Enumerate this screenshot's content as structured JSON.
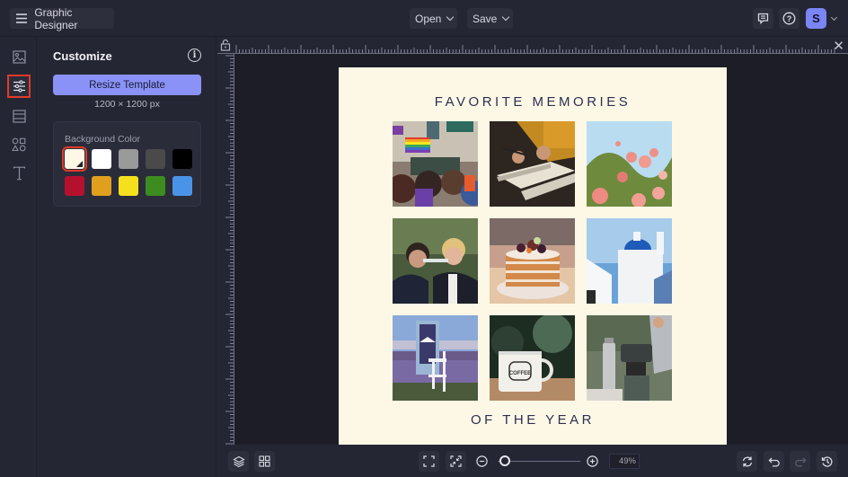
{
  "header": {
    "app_title": "Graphic Designer",
    "open_label": "Open",
    "save_label": "Save",
    "avatar_initial": "S",
    "icons": [
      "menu-icon",
      "chevron-down-icon",
      "comment-icon",
      "help-icon",
      "avatar",
      "chevron-down-icon"
    ]
  },
  "rail": {
    "items": [
      {
        "name": "photos",
        "icon": "image-icon",
        "active": false
      },
      {
        "name": "customize",
        "icon": "sliders-icon",
        "active": true
      },
      {
        "name": "layouts",
        "icon": "layout-icon",
        "active": false
      },
      {
        "name": "graphics",
        "icon": "shapes-icon",
        "active": false
      },
      {
        "name": "text",
        "icon": "text-icon",
        "active": false
      }
    ]
  },
  "panel": {
    "title": "Customize",
    "resize_label": "Resize Template",
    "size_text": "1200 × 1200 px",
    "background_label": "Background Color",
    "swatches": [
      {
        "name": "cream-custom",
        "color": "#fdf8e6",
        "selected": true
      },
      {
        "name": "white",
        "color": "#ffffff",
        "selected": false
      },
      {
        "name": "gray",
        "color": "#9a9a9a",
        "selected": false
      },
      {
        "name": "dark-gray",
        "color": "#4a4a4a",
        "selected": false
      },
      {
        "name": "black",
        "color": "#000000",
        "selected": false
      },
      {
        "name": "red",
        "color": "#b5112e",
        "selected": false
      },
      {
        "name": "orange",
        "color": "#e0a01e",
        "selected": false
      },
      {
        "name": "yellow",
        "color": "#f6e01e",
        "selected": false
      },
      {
        "name": "green",
        "color": "#3d8c1f",
        "selected": false
      },
      {
        "name": "blue",
        "color": "#4a94e8",
        "selected": false
      }
    ]
  },
  "design": {
    "title_top": "FAVORITE MEMORIES",
    "title_bottom": "OF THE YEAR",
    "background": "#fdf8e6",
    "photos": [
      {
        "subject": "pride parade crowd with rainbow flag"
      },
      {
        "subject": "hands writing in notebook"
      },
      {
        "subject": "pink roses against blue sky"
      },
      {
        "subject": "two men drinking champagne"
      },
      {
        "subject": "layered naked cake with berries"
      },
      {
        "subject": "white church with blue dome"
      },
      {
        "subject": "window frame and chair in lavender field"
      },
      {
        "subject": "enamel coffee mug"
      },
      {
        "subject": "camping stove with pot and bottle"
      }
    ]
  },
  "bottombar": {
    "zoom_value": "49%",
    "zoom_fraction": 0.06,
    "icons": [
      "layers-icon",
      "grid-icon",
      "fit-screen-icon",
      "shrink-icon",
      "zoom-out-icon",
      "zoom-in-icon",
      "refresh-icon",
      "undo-icon",
      "redo-icon",
      "history-icon"
    ]
  }
}
